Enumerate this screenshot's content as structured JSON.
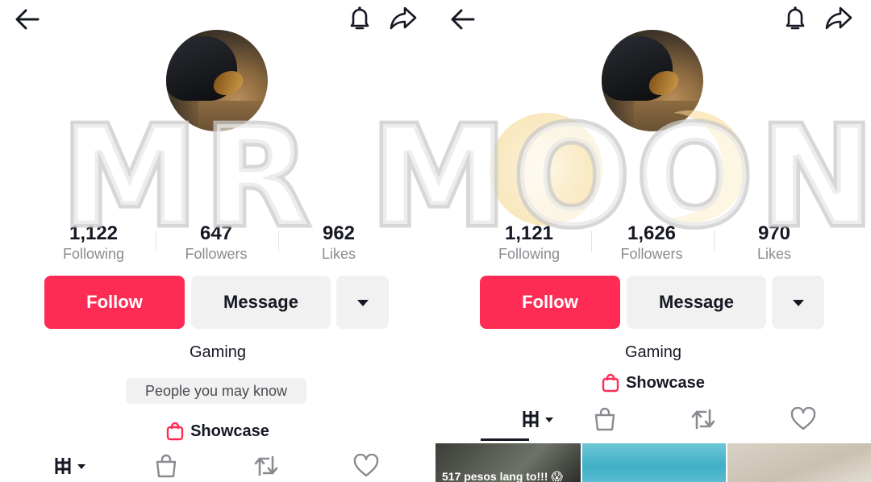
{
  "watermark": {
    "text": "MR MOON"
  },
  "colors": {
    "accent": "#fe2c55",
    "button_gray": "#f1f1f2",
    "text_primary": "#161823",
    "text_secondary": "#8a8b91"
  },
  "left": {
    "header": {
      "icons": [
        "back-arrow-icon",
        "bell-icon",
        "share-icon"
      ]
    },
    "stats": [
      {
        "value": "1,122",
        "label": "Following"
      },
      {
        "value": "647",
        "label": "Followers"
      },
      {
        "value": "962",
        "label": "Likes"
      }
    ],
    "actions": {
      "follow": "Follow",
      "message": "Message"
    },
    "bio": "Gaming",
    "suggestion": "People you may know",
    "showcase": "Showcase",
    "tabs": [
      "videos-grid-icon",
      "shop-bag-icon",
      "repost-icon",
      "liked-heart-icon"
    ]
  },
  "right": {
    "header": {
      "icons": [
        "back-arrow-icon",
        "bell-icon",
        "share-icon"
      ]
    },
    "stats": [
      {
        "value": "1,121",
        "label": "Following"
      },
      {
        "value": "1,626",
        "label": "Followers"
      },
      {
        "value": "970",
        "label": "Likes"
      }
    ],
    "actions": {
      "follow": "Follow",
      "message": "Message"
    },
    "bio": "Gaming",
    "showcase": "Showcase",
    "tabs": [
      "videos-grid-icon",
      "shop-bag-icon",
      "repost-icon",
      "liked-heart-icon"
    ],
    "videos": [
      {
        "caption": "517 pesos lang to!!! 😱"
      },
      {
        "caption": ""
      },
      {
        "caption": ""
      }
    ]
  }
}
